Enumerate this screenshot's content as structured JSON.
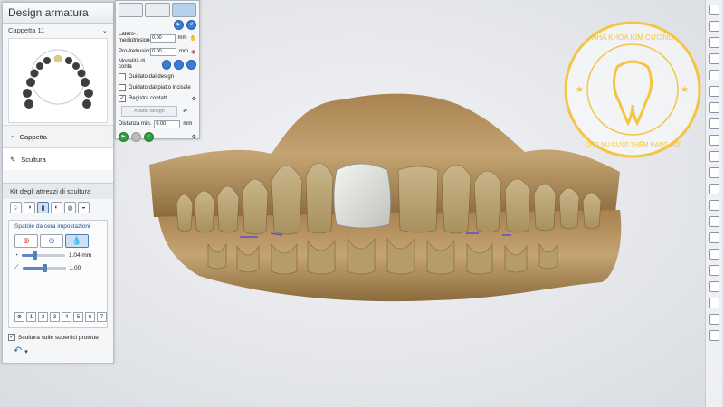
{
  "panel": {
    "title": "Design armatura",
    "subtitle": "Cappetta 11",
    "sections": [
      {
        "label": "Cappetta",
        "icon": "tooth-icon"
      },
      {
        "label": "Scultura",
        "icon": "sculpt-icon"
      }
    ],
    "toolkit_title": "Kit degli attrezzi di scultura",
    "wax_settings_title": "Spatole da cera impostazioni",
    "slider1_value": "1.04 mm",
    "slider2_value": "1.00",
    "slider1_level": 0.3,
    "slider2_level": 0.5,
    "numbers": [
      "1",
      "2",
      "3",
      "4",
      "5",
      "6",
      "7"
    ],
    "protected_label": "Scultura sulle superfici protette"
  },
  "dialog": {
    "latero_label": "Latero- / mediotrusione",
    "latero_value": "0.00",
    "latero_unit": "mm",
    "pro_label": "Pro-/retrusion",
    "pro_value": "0.00",
    "pro_unit": "mm",
    "contact_mode_label": "Modalità di conta",
    "check1": "Guidato dal design",
    "check2": "Guidato dal piatto incisale",
    "check3": "Registra contatti",
    "adapt_button": "Adatta design",
    "min_distance_label": "Distanza min.",
    "min_distance_value": "0.00",
    "min_distance_unit": "mm"
  },
  "logo": {
    "ring_text_top": "NHA KHOA KIM CƯƠNG",
    "ring_text_bottom": "CHO NỤ CƯỜI THÊM RẠNG RỠ"
  },
  "colors": {
    "gum": "#c9a874",
    "tooth": "#d9c7a0",
    "crown": "#e4e6e2",
    "gold": "#f4c542"
  }
}
